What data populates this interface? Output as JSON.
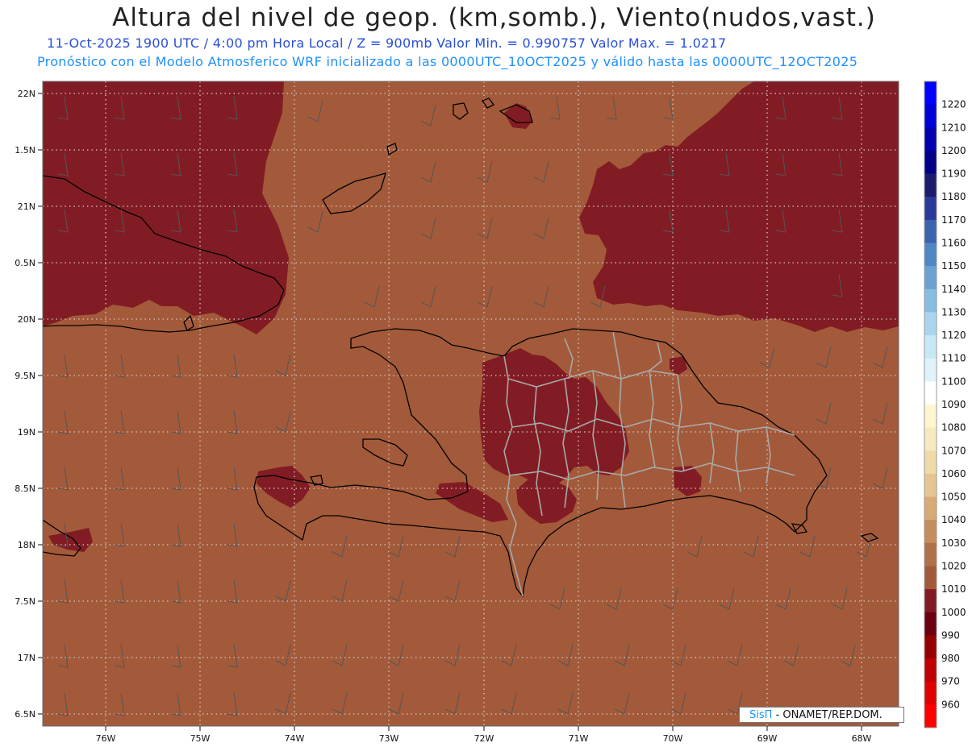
{
  "header": {
    "title": "Altura del nivel de geop. (km,somb.), Viento(nudos,vast.)",
    "subtitle1": "11-Oct-2025  1900 UTC / 4:00 pm Hora Local / Z = 900mb     Valor Min. = 0.990757  Valor Max. = 1.0217",
    "subtitle2": "Pronóstico con el Modelo Atmosferico WRF inicializado a las 0000UTC_10OCT2025 y válido hasta las  0000UTC_12OCT2025"
  },
  "map": {
    "lat_labels": [
      "22N",
      "1.5N",
      "21N",
      "0.5N",
      "20N",
      "9.5N",
      "19N",
      "8.5N",
      "18N",
      "7.5N",
      "17N",
      "6.5N"
    ],
    "lon_labels": [
      "76W",
      "75W",
      "74W",
      "73W",
      "72W",
      "71W",
      "70W",
      "69W",
      "68W"
    ],
    "background_color": "#a35a3a",
    "low_color": "#821c24"
  },
  "colorbar": {
    "levels": [
      "1220",
      "1210",
      "1200",
      "1190",
      "1180",
      "1170",
      "1160",
      "1150",
      "1140",
      "1130",
      "1120",
      "1110",
      "1100",
      "1090",
      "1080",
      "1070",
      "1060",
      "1050",
      "1040",
      "1030",
      "1020",
      "1010",
      "1000",
      "990",
      "980",
      "970",
      "960"
    ],
    "colors": [
      "#0000ff",
      "#0000d8",
      "#0000b0",
      "#000088",
      "#1c1c6e",
      "#2a3a9a",
      "#3b63b0",
      "#4f86c4",
      "#6aa2d4",
      "#86bde0",
      "#a9d6ee",
      "#c8e8f6",
      "#def4fa",
      "#ffffff",
      "#fff6d0",
      "#f7eac0",
      "#efdaa8",
      "#e5c690",
      "#d8ab74",
      "#c68d5c",
      "#b07048",
      "#a35a3a",
      "#821c24",
      "#6c0010",
      "#960000",
      "#c00000",
      "#e00000",
      "#ff0000"
    ]
  },
  "credit": {
    "brand": "SisΠ",
    "org": "- ONAMET/REP.DOM."
  }
}
